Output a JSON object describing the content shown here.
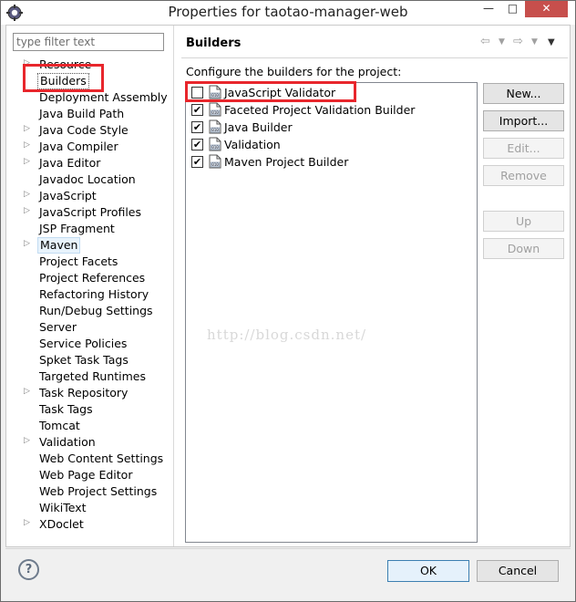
{
  "window": {
    "title": "Properties for taotao-manager-web",
    "controls": [
      "—",
      "□",
      "✕"
    ]
  },
  "filter": {
    "placeholder": "type filter text",
    "value": ""
  },
  "nav": {
    "items": [
      {
        "label": "Resource",
        "expandable": true
      },
      {
        "label": "Builders",
        "expandable": false
      },
      {
        "label": "Deployment Assembly",
        "expandable": false
      },
      {
        "label": "Java Build Path",
        "expandable": false
      },
      {
        "label": "Java Code Style",
        "expandable": true
      },
      {
        "label": "Java Compiler",
        "expandable": true
      },
      {
        "label": "Java Editor",
        "expandable": true
      },
      {
        "label": "Javadoc Location",
        "expandable": false
      },
      {
        "label": "JavaScript",
        "expandable": true
      },
      {
        "label": "JavaScript Profiles",
        "expandable": true
      },
      {
        "label": "JSP Fragment",
        "expandable": false
      },
      {
        "label": "Maven",
        "expandable": true
      },
      {
        "label": "Project Facets",
        "expandable": false
      },
      {
        "label": "Project References",
        "expandable": false
      },
      {
        "label": "Refactoring History",
        "expandable": false
      },
      {
        "label": "Run/Debug Settings",
        "expandable": false
      },
      {
        "label": "Server",
        "expandable": false
      },
      {
        "label": "Service Policies",
        "expandable": false
      },
      {
        "label": "Spket Task Tags",
        "expandable": false
      },
      {
        "label": "Targeted Runtimes",
        "expandable": false
      },
      {
        "label": "Task Repository",
        "expandable": true
      },
      {
        "label": "Task Tags",
        "expandable": false
      },
      {
        "label": "Tomcat",
        "expandable": false
      },
      {
        "label": "Validation",
        "expandable": true
      },
      {
        "label": "Web Content Settings",
        "expandable": false
      },
      {
        "label": "Web Page Editor",
        "expandable": false
      },
      {
        "label": "Web Project Settings",
        "expandable": false
      },
      {
        "label": "WikiText",
        "expandable": false
      },
      {
        "label": "XDoclet",
        "expandable": true
      }
    ]
  },
  "page": {
    "title": "Builders",
    "description": "Configure the builders for the project:",
    "builders": [
      {
        "name": "JavaScript Validator",
        "checked": false
      },
      {
        "name": "Faceted Project Validation Builder",
        "checked": true
      },
      {
        "name": "Java Builder",
        "checked": true
      },
      {
        "name": "Validation",
        "checked": true
      },
      {
        "name": "Maven Project Builder",
        "checked": true
      }
    ],
    "watermark": "http://blog.csdn.net/",
    "buttons": {
      "new": "New...",
      "import": "Import...",
      "edit": "Edit...",
      "remove": "Remove",
      "up": "Up",
      "down": "Down"
    }
  },
  "footer": {
    "help": "?",
    "ok": "OK",
    "cancel": "Cancel"
  },
  "colors": {
    "annotation": "#e8262c",
    "accent": "#3c7fb1"
  }
}
